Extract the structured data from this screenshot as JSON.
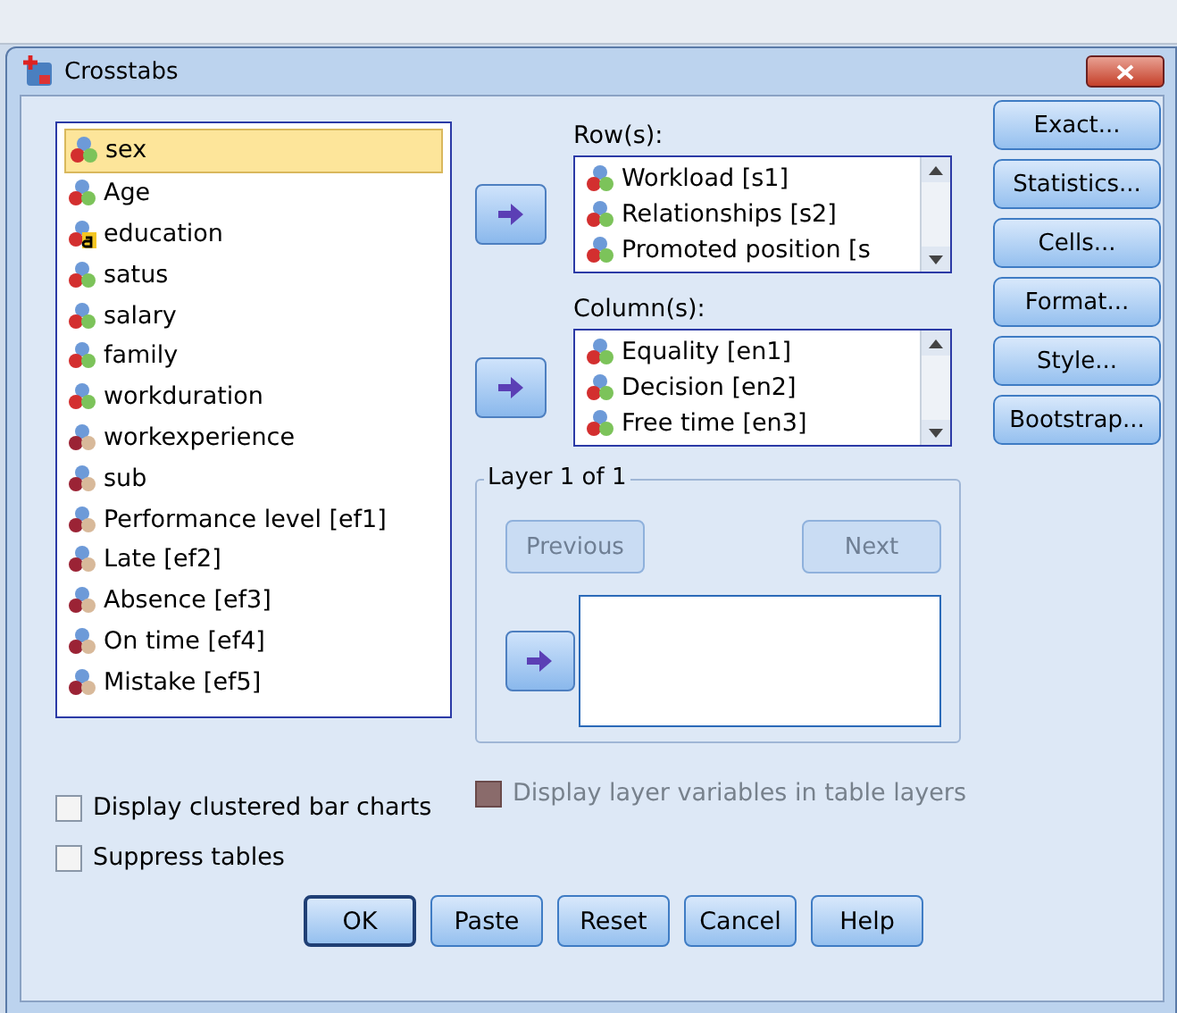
{
  "window": {
    "title": "Crosstabs"
  },
  "variables": [
    {
      "name": "sex",
      "kind": "nominal",
      "selected": true
    },
    {
      "name": "Age",
      "kind": "nominal",
      "selected": false
    },
    {
      "name": "education",
      "kind": "string",
      "selected": false
    },
    {
      "name": "satus",
      "kind": "nominal",
      "selected": false
    },
    {
      "name": "salary",
      "kind": "nominal",
      "selected": false
    },
    {
      "name": "family",
      "kind": "nominal",
      "selected": false
    },
    {
      "name": "workduration",
      "kind": "nominal",
      "selected": false
    },
    {
      "name": "workexperience",
      "kind": "ordinal",
      "selected": false
    },
    {
      "name": "sub",
      "kind": "ordinal",
      "selected": false
    },
    {
      "name": "Performance level [ef1]",
      "kind": "ordinal",
      "selected": false
    },
    {
      "name": "Late [ef2]",
      "kind": "ordinal",
      "selected": false
    },
    {
      "name": "Absence [ef3]",
      "kind": "ordinal",
      "selected": false
    },
    {
      "name": "On time [ef4]",
      "kind": "ordinal",
      "selected": false
    },
    {
      "name": "Mistake [ef5]",
      "kind": "ordinal",
      "selected": false
    }
  ],
  "rows": {
    "label": "Row(s):",
    "items": [
      {
        "name": "Workload [s1]",
        "kind": "nominal"
      },
      {
        "name": "Relationships [s2]",
        "kind": "nominal"
      },
      {
        "name": "Promoted position [s",
        "kind": "nominal"
      }
    ]
  },
  "columns": {
    "label": "Column(s):",
    "items": [
      {
        "name": "Equality [en1]",
        "kind": "nominal"
      },
      {
        "name": "Decision [en2]",
        "kind": "nominal"
      },
      {
        "name": "Free time [en3]",
        "kind": "nominal"
      }
    ]
  },
  "side_buttons": [
    "Exact...",
    "Statistics...",
    "Cells...",
    "Format...",
    "Style...",
    "Bootstrap..."
  ],
  "layer": {
    "title": "Layer 1 of 1",
    "previous": {
      "label": "Previous",
      "disabled": true
    },
    "next": {
      "label": "Next",
      "disabled": true
    }
  },
  "display_layer": {
    "label": "Display layer variables in table layers",
    "checked": false,
    "disabled": true
  },
  "options": [
    {
      "label": "Display clustered bar charts",
      "checked": false
    },
    {
      "label": "Suppress tables",
      "checked": false
    }
  ],
  "buttons": [
    {
      "label": "OK",
      "default": true
    },
    {
      "label": "Paste",
      "default": false
    },
    {
      "label": "Reset",
      "default": false
    },
    {
      "label": "Cancel",
      "default": false
    },
    {
      "label": "Help",
      "default": false
    }
  ]
}
